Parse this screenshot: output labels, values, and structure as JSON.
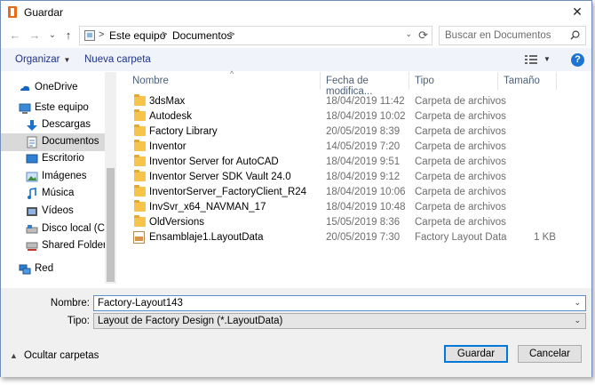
{
  "window": {
    "title": "Guardar",
    "close_glyph": "✕"
  },
  "nav": {
    "back_glyph": "←",
    "forward_glyph": "→",
    "recent_glyph": "⌄",
    "up_glyph": "↑",
    "breadcrumbs": [
      "Este equipo",
      "Documentos"
    ],
    "separator": ">",
    "search_placeholder": "Buscar en Documentos"
  },
  "toolbar": {
    "organize_label": "Organizar",
    "new_folder_label": "Nueva carpeta"
  },
  "sidebar": {
    "items": [
      {
        "label": "OneDrive",
        "icon": "cloud-icon"
      },
      {
        "label": "Este equipo",
        "icon": "computer-icon"
      },
      {
        "label": "Descargas",
        "icon": "download-icon"
      },
      {
        "label": "Documentos",
        "icon": "document-icon"
      },
      {
        "label": "Escritorio",
        "icon": "desktop-icon"
      },
      {
        "label": "Imágenes",
        "icon": "pictures-icon"
      },
      {
        "label": "Música",
        "icon": "music-icon"
      },
      {
        "label": "Vídeos",
        "icon": "videos-icon"
      },
      {
        "label": "Disco local (C:)",
        "icon": "drive-icon"
      },
      {
        "label": "Shared Folders (\\",
        "icon": "network-drive-icon"
      },
      {
        "label": "Red",
        "icon": "network-icon"
      }
    ],
    "selected": "Documentos"
  },
  "columns": {
    "name": "Nombre",
    "date": "Fecha de modifica...",
    "type": "Tipo",
    "size": "Tamaño",
    "sort_glyph": "^"
  },
  "files": [
    {
      "name": "3dsMax",
      "date": "18/04/2019 11:42",
      "type": "Carpeta de archivos",
      "size": "",
      "kind": "folder"
    },
    {
      "name": "Autodesk",
      "date": "18/04/2019 10:02",
      "type": "Carpeta de archivos",
      "size": "",
      "kind": "folder"
    },
    {
      "name": "Factory Library",
      "date": "20/05/2019 8:39",
      "type": "Carpeta de archivos",
      "size": "",
      "kind": "folder"
    },
    {
      "name": "Inventor",
      "date": "14/05/2019 7:20",
      "type": "Carpeta de archivos",
      "size": "",
      "kind": "folder"
    },
    {
      "name": "Inventor Server for AutoCAD",
      "date": "18/04/2019 9:51",
      "type": "Carpeta de archivos",
      "size": "",
      "kind": "folder"
    },
    {
      "name": "Inventor Server SDK Vault 24.0",
      "date": "18/04/2019 9:12",
      "type": "Carpeta de archivos",
      "size": "",
      "kind": "folder"
    },
    {
      "name": "InventorServer_FactoryClient_R24",
      "date": "18/04/2019 10:06",
      "type": "Carpeta de archivos",
      "size": "",
      "kind": "folder"
    },
    {
      "name": "InvSvr_x64_NAVMAN_17",
      "date": "18/04/2019 10:48",
      "type": "Carpeta de archivos",
      "size": "",
      "kind": "folder"
    },
    {
      "name": "OldVersions",
      "date": "15/05/2019 8:36",
      "type": "Carpeta de archivos",
      "size": "",
      "kind": "folder"
    },
    {
      "name": "Ensamblaje1.LayoutData",
      "date": "20/05/2019 7:30",
      "type": "Factory Layout Data",
      "size": "1 KB",
      "kind": "file"
    }
  ],
  "form": {
    "name_label": "Nombre:",
    "name_value": "Factory-Layout143",
    "type_label": "Tipo:",
    "type_value": "Layout de Factory Design (*.LayoutData)",
    "dropdown_glyph": "⌄"
  },
  "footer": {
    "hide_folders_label": "Ocultar carpetas",
    "save_label": "Guardar",
    "cancel_label": "Cancelar"
  }
}
